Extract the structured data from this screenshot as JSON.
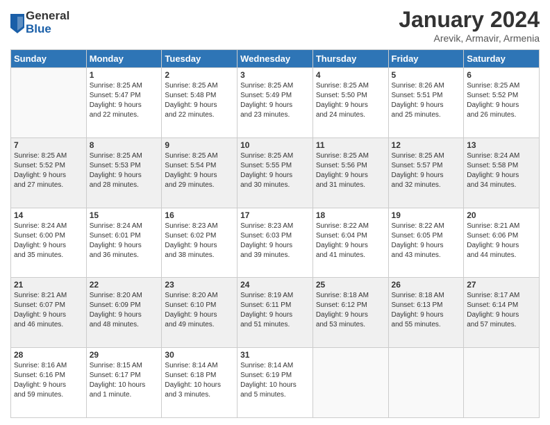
{
  "header": {
    "logo": {
      "general": "General",
      "blue": "Blue"
    },
    "title": "January 2024",
    "subtitle": "Arevik, Armavir, Armenia"
  },
  "calendar": {
    "days_of_week": [
      "Sunday",
      "Monday",
      "Tuesday",
      "Wednesday",
      "Thursday",
      "Friday",
      "Saturday"
    ],
    "weeks": [
      {
        "cells": [
          {
            "day": "",
            "content": ""
          },
          {
            "day": "1",
            "content": "Sunrise: 8:25 AM\nSunset: 5:47 PM\nDaylight: 9 hours\nand 22 minutes."
          },
          {
            "day": "2",
            "content": "Sunrise: 8:25 AM\nSunset: 5:48 PM\nDaylight: 9 hours\nand 22 minutes."
          },
          {
            "day": "3",
            "content": "Sunrise: 8:25 AM\nSunset: 5:49 PM\nDaylight: 9 hours\nand 23 minutes."
          },
          {
            "day": "4",
            "content": "Sunrise: 8:25 AM\nSunset: 5:50 PM\nDaylight: 9 hours\nand 24 minutes."
          },
          {
            "day": "5",
            "content": "Sunrise: 8:26 AM\nSunset: 5:51 PM\nDaylight: 9 hours\nand 25 minutes."
          },
          {
            "day": "6",
            "content": "Sunrise: 8:25 AM\nSunset: 5:52 PM\nDaylight: 9 hours\nand 26 minutes."
          }
        ]
      },
      {
        "cells": [
          {
            "day": "7",
            "content": "Sunrise: 8:25 AM\nSunset: 5:52 PM\nDaylight: 9 hours\nand 27 minutes."
          },
          {
            "day": "8",
            "content": "Sunrise: 8:25 AM\nSunset: 5:53 PM\nDaylight: 9 hours\nand 28 minutes."
          },
          {
            "day": "9",
            "content": "Sunrise: 8:25 AM\nSunset: 5:54 PM\nDaylight: 9 hours\nand 29 minutes."
          },
          {
            "day": "10",
            "content": "Sunrise: 8:25 AM\nSunset: 5:55 PM\nDaylight: 9 hours\nand 30 minutes."
          },
          {
            "day": "11",
            "content": "Sunrise: 8:25 AM\nSunset: 5:56 PM\nDaylight: 9 hours\nand 31 minutes."
          },
          {
            "day": "12",
            "content": "Sunrise: 8:25 AM\nSunset: 5:57 PM\nDaylight: 9 hours\nand 32 minutes."
          },
          {
            "day": "13",
            "content": "Sunrise: 8:24 AM\nSunset: 5:58 PM\nDaylight: 9 hours\nand 34 minutes."
          }
        ]
      },
      {
        "cells": [
          {
            "day": "14",
            "content": "Sunrise: 8:24 AM\nSunset: 6:00 PM\nDaylight: 9 hours\nand 35 minutes."
          },
          {
            "day": "15",
            "content": "Sunrise: 8:24 AM\nSunset: 6:01 PM\nDaylight: 9 hours\nand 36 minutes."
          },
          {
            "day": "16",
            "content": "Sunrise: 8:23 AM\nSunset: 6:02 PM\nDaylight: 9 hours\nand 38 minutes."
          },
          {
            "day": "17",
            "content": "Sunrise: 8:23 AM\nSunset: 6:03 PM\nDaylight: 9 hours\nand 39 minutes."
          },
          {
            "day": "18",
            "content": "Sunrise: 8:22 AM\nSunset: 6:04 PM\nDaylight: 9 hours\nand 41 minutes."
          },
          {
            "day": "19",
            "content": "Sunrise: 8:22 AM\nSunset: 6:05 PM\nDaylight: 9 hours\nand 43 minutes."
          },
          {
            "day": "20",
            "content": "Sunrise: 8:21 AM\nSunset: 6:06 PM\nDaylight: 9 hours\nand 44 minutes."
          }
        ]
      },
      {
        "cells": [
          {
            "day": "21",
            "content": "Sunrise: 8:21 AM\nSunset: 6:07 PM\nDaylight: 9 hours\nand 46 minutes."
          },
          {
            "day": "22",
            "content": "Sunrise: 8:20 AM\nSunset: 6:09 PM\nDaylight: 9 hours\nand 48 minutes."
          },
          {
            "day": "23",
            "content": "Sunrise: 8:20 AM\nSunset: 6:10 PM\nDaylight: 9 hours\nand 49 minutes."
          },
          {
            "day": "24",
            "content": "Sunrise: 8:19 AM\nSunset: 6:11 PM\nDaylight: 9 hours\nand 51 minutes."
          },
          {
            "day": "25",
            "content": "Sunrise: 8:18 AM\nSunset: 6:12 PM\nDaylight: 9 hours\nand 53 minutes."
          },
          {
            "day": "26",
            "content": "Sunrise: 8:18 AM\nSunset: 6:13 PM\nDaylight: 9 hours\nand 55 minutes."
          },
          {
            "day": "27",
            "content": "Sunrise: 8:17 AM\nSunset: 6:14 PM\nDaylight: 9 hours\nand 57 minutes."
          }
        ]
      },
      {
        "cells": [
          {
            "day": "28",
            "content": "Sunrise: 8:16 AM\nSunset: 6:16 PM\nDaylight: 9 hours\nand 59 minutes."
          },
          {
            "day": "29",
            "content": "Sunrise: 8:15 AM\nSunset: 6:17 PM\nDaylight: 10 hours\nand 1 minute."
          },
          {
            "day": "30",
            "content": "Sunrise: 8:14 AM\nSunset: 6:18 PM\nDaylight: 10 hours\nand 3 minutes."
          },
          {
            "day": "31",
            "content": "Sunrise: 8:14 AM\nSunset: 6:19 PM\nDaylight: 10 hours\nand 5 minutes."
          },
          {
            "day": "",
            "content": ""
          },
          {
            "day": "",
            "content": ""
          },
          {
            "day": "",
            "content": ""
          }
        ]
      }
    ]
  }
}
